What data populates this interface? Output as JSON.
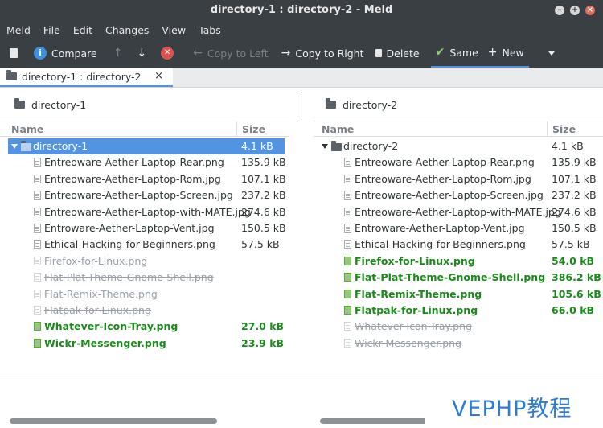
{
  "window": {
    "title": "directory-1 : directory-2 - Meld"
  },
  "menu": [
    "Meld",
    "File",
    "Edit",
    "Changes",
    "View",
    "Tabs"
  ],
  "toolbar": {
    "compare": "Compare",
    "copy_left": "Copy to Left",
    "copy_right": "Copy to Right",
    "delete": "Delete",
    "same": "Same",
    "new": "New"
  },
  "tab": {
    "label": "directory-1 : directory-2",
    "close": "×"
  },
  "left": {
    "path": "directory-1",
    "col_name": "Name",
    "col_size": "Size",
    "rows": [
      {
        "name": "directory-1",
        "size": "4.1 kB",
        "state": "folder"
      },
      {
        "name": "Entreoware-Aether-Laptop-Rear.png",
        "size": "135.9 kB",
        "state": "same"
      },
      {
        "name": "Entreoware-Aether-Laptop-Rom.jpg",
        "size": "107.1 kB",
        "state": "same"
      },
      {
        "name": "Entreoware-Aether-Laptop-Screen.jpg",
        "size": "237.2 kB",
        "state": "same"
      },
      {
        "name": "Entreoware-Aether-Laptop-with-MATE.jpg",
        "size": "274.6 kB",
        "state": "same"
      },
      {
        "name": "Entroware-Aether-Laptop-Vent.jpg",
        "size": "150.5 kB",
        "state": "same"
      },
      {
        "name": "Ethical-Hacking-for-Beginners.png",
        "size": "57.5 kB",
        "state": "same"
      },
      {
        "name": "Firefox-for-Linux.png",
        "size": "",
        "state": "missing"
      },
      {
        "name": "Flat-Plat-Theme-Gnome-Shell.png",
        "size": "",
        "state": "missing"
      },
      {
        "name": "Flat-Remix-Theme.png",
        "size": "",
        "state": "missing"
      },
      {
        "name": "Flatpak-for-Linux.png",
        "size": "",
        "state": "missing"
      },
      {
        "name": "Whatever-Icon-Tray.png",
        "size": "27.0 kB",
        "state": "new"
      },
      {
        "name": "Wickr-Messenger.png",
        "size": "23.9 kB",
        "state": "new"
      }
    ]
  },
  "right": {
    "path": "directory-2",
    "col_name": "Name",
    "col_size": "Size",
    "rows": [
      {
        "name": "directory-2",
        "size": "4.1 kB",
        "state": "folder"
      },
      {
        "name": "Entreoware-Aether-Laptop-Rear.png",
        "size": "135.9 kB",
        "state": "same"
      },
      {
        "name": "Entreoware-Aether-Laptop-Rom.jpg",
        "size": "107.1 kB",
        "state": "same"
      },
      {
        "name": "Entreoware-Aether-Laptop-Screen.jpg",
        "size": "237.2 kB",
        "state": "same"
      },
      {
        "name": "Entreoware-Aether-Laptop-with-MATE.jpg",
        "size": "274.6 kB",
        "state": "same"
      },
      {
        "name": "Entroware-Aether-Laptop-Vent.jpg",
        "size": "150.5 kB",
        "state": "same"
      },
      {
        "name": "Ethical-Hacking-for-Beginners.png",
        "size": "57.5 kB",
        "state": "same"
      },
      {
        "name": "Firefox-for-Linux.png",
        "size": "54.0 kB",
        "state": "new"
      },
      {
        "name": "Flat-Plat-Theme-Gnome-Shell.png",
        "size": "386.2 kB",
        "state": "new"
      },
      {
        "name": "Flat-Remix-Theme.png",
        "size": "105.6 kB",
        "state": "new"
      },
      {
        "name": "Flatpak-for-Linux.png",
        "size": "66.0 kB",
        "state": "new"
      },
      {
        "name": "Whatever-Icon-Tray.png",
        "size": "",
        "state": "missing"
      },
      {
        "name": "Wickr-Messenger.png",
        "size": "",
        "state": "missing"
      }
    ]
  },
  "watermark": "VEPHP教程",
  "colors": {
    "accent": "#5294e2",
    "new": "#1a8a1a",
    "chrome": "#3a3f44"
  }
}
